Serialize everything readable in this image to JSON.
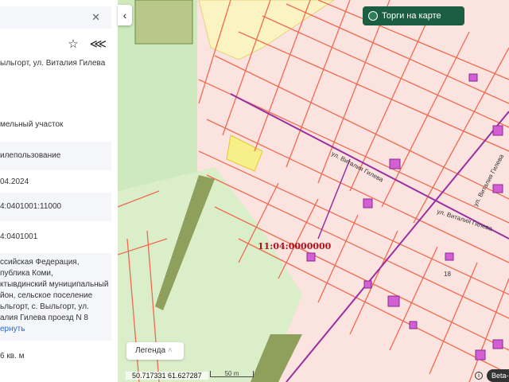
{
  "panel": {
    "close_icon": "close-icon",
    "address": "ыльгорт, ул. Виталия Гилева",
    "type": "мельный участок",
    "usage": "илепользование",
    "date": "04.2024",
    "cad_number": "4:0401001:11000",
    "cad_quarter": "4:0401001",
    "full_address": [
      "ссийская Федерация,",
      "публика Коми,",
      "ктывдинский муниципальный",
      "йон, сельское поселение",
      "ьльгорт, с. Выльгорт, ул.",
      "алия Гилева проезд N 8"
    ],
    "collapse_link": "ернуть",
    "area": "6 кв. м"
  },
  "map": {
    "torgi_button": "Торги на карте",
    "legend": "Легенда",
    "coords": "50.717331   61.627287",
    "scale": "50 m",
    "beta": "Beta-в",
    "cad_label": "11:04:0000000",
    "street1": "ул. Виталия Гилева",
    "street2": "ул. Виталия Гилева",
    "street3": "ул. Виталия Гилева",
    "house": "18"
  }
}
